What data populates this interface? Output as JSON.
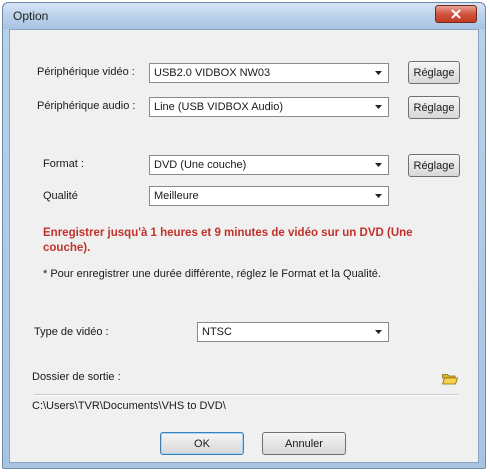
{
  "window": {
    "title": "Option"
  },
  "device": {
    "video_label": "Périphérique vidéo :",
    "video_value": "USB2.0 VIDBOX NW03",
    "audio_label": "Périphérique audio :",
    "audio_value": "Line (USB VIDBOX Audio)",
    "settings_label": "Réglage"
  },
  "format": {
    "format_label": "Format :",
    "format_value": "DVD (Une couche)",
    "quality_label": "Qualité",
    "quality_value": "Meilleure",
    "settings_label": "Réglage"
  },
  "info": {
    "warning": "Enregistrer jusqu'à 1 heures et 9 minutes de vidéo sur un DVD (Une couche).",
    "note": "* Pour enregistrer une durée différente, réglez le Format et la Qualité."
  },
  "video_type": {
    "label": "Type de vidéo :",
    "value": "NTSC"
  },
  "output": {
    "label": "Dossier de sortie :",
    "path": "C:\\Users\\TVR\\Documents\\VHS to DVD\\",
    "icon": "folder-icon"
  },
  "buttons": {
    "ok": "OK",
    "cancel": "Annuler"
  },
  "colors": {
    "warning": "#c0322b",
    "close": "#c23a22"
  }
}
